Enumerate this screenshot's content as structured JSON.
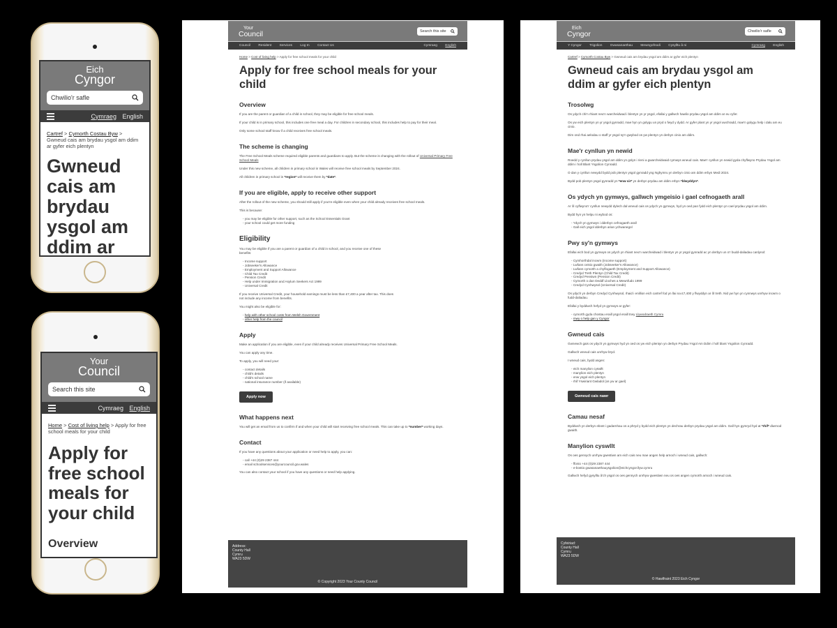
{
  "mobile_cy": {
    "logo_top": "Eich",
    "logo_bottom": "Cyngor",
    "search_placeholder": "Chwilio'r safle",
    "lang_cy": "Cymraeg",
    "lang_en": "English",
    "breadcrumb": [
      "Cartref",
      "Cymorth Costau Byw",
      "Gwneud cais am brydau ysgol am ddim ar gyfer eich plentyn"
    ],
    "title": "Gwneud cais am brydau ysgol am ddim ar gyfer eich plentyn"
  },
  "mobile_en": {
    "logo_top": "Your",
    "logo_bottom": "Council",
    "search_placeholder": "Search this site",
    "lang_cy": "Cymraeg",
    "lang_en": "English",
    "breadcrumb": [
      "Home",
      "Cost of living help",
      "Apply for free school meals for your child"
    ],
    "title": "Apply for free school meals for your child",
    "first_heading": "Overview"
  },
  "desktop_en": {
    "logo_top": "Your",
    "logo_bottom": "Council",
    "search_placeholder": "Search this site",
    "nav": [
      "Council",
      "Resident",
      "Services",
      "Log In",
      "Contact Us"
    ],
    "lang_cy": "Cymraeg",
    "lang_en": "English",
    "breadcrumb": [
      "Home",
      "Cost of living help",
      "Apply for free school meals for your child"
    ],
    "title": "Apply for free school meals for your child",
    "overview": {
      "heading": "Overview",
      "p1": "If you are the parent or guardian of a child in school, they may be eligible for free school meals.",
      "p2": "If your child is in primary school, this includes one free meal a day. For children in secondary school, this includes help to pay for their meal.",
      "p3": "Only some school staff know if a child receives free school meals."
    },
    "scheme": {
      "heading": "The scheme is changing",
      "p1_pre": "The Free School Meals scheme required eligible parents and guardians to apply. But the scheme is changing with the rollout of ",
      "p1_link": "Universal Primary Free School Meals",
      "p2": "Under this new scheme, all children in primary school in Wales will receive free school meals by September 2024.",
      "p3_pre": "All children in primary school in ",
      "p3_region": "*region*",
      "p3_mid": " will receive them by ",
      "p3_date": "*date*"
    },
    "other_support": {
      "heading": "If you are eligible, apply to receive other support",
      "p1": "After the rollout of the new scheme, you should still apply if you're eligible even when your child already receives free school meals.",
      "p2": "This is because:",
      "items": [
        "you may be eligible for other support, such as the School Essentials Grant",
        "your school could get more funding"
      ]
    },
    "eligibility": {
      "heading": "Eligibility",
      "p1": "You may be eligible if you are a parent or guardian of a child in school, and you receive one of these benefits:",
      "benefits": [
        "Income support",
        "Jobseeker's Allowance",
        "Employment and Support Allowance",
        "Child Tax Credit",
        "Pension Credit",
        "Help under Immigration and Asylum Seekers Act 1999",
        "Universal Credit"
      ],
      "p2": "If you receive Universal Credit, your household earnings must be less than £7,400 a year after tax. This does not include any income from benefits.",
      "p3": "You might also be eligible for:",
      "links": [
        "help with other school costs from Welsh Government",
        "other help from the council"
      ]
    },
    "apply": {
      "heading": "Apply",
      "p1": "Make an application if you are eligible, even if your child already receives Universal Primary Free School Meals.",
      "p2": "You can apply any time.",
      "p3": "To apply, you will need your:",
      "items": [
        "contact details",
        "child's details",
        "child's school name",
        "national insurance number (if available)"
      ],
      "button": "Apply now"
    },
    "next": {
      "heading": "What happens next",
      "p1_pre": "You will get an email from us to confirm if and when your child will start receiving free school meals. This can take up to ",
      "p1_num": "*number*",
      "p1_post": " working days."
    },
    "contact": {
      "heading": "Contact",
      "p1": "If you have any questions about your application or need help to apply, you can:",
      "items": [
        "call +44 (0)29 2387 444",
        "email schoolservices@yourcouncil.gov.wales"
      ],
      "p2": "You can also contact your school if you have any questions or need help applying."
    },
    "footer": {
      "address": [
        "Address:",
        "County Hall",
        "Cymru",
        "WA23 5DW"
      ],
      "copyright": "© Copyright 2023 Your County Council"
    }
  },
  "desktop_cy": {
    "logo_top": "Eich",
    "logo_bottom": "Cyngor",
    "search_placeholder": "Chwilio'r safle",
    "nav": [
      "Y Cyngor",
      "Trigolion",
      "Gwasanaethau",
      "Mewngofnodi",
      "Cysylltu â ni"
    ],
    "lang_cy": "Cymraeg",
    "lang_en": "English",
    "breadcrumb": [
      "Cartref",
      "Cymorth Costau Byw",
      "Gwneud cais am brydau ysgol am ddim ar gyfer eich plentyn"
    ],
    "title": "Gwneud cais am brydau ysgol am ddim ar gyfer eich plentyn",
    "overview": {
      "heading": "Trosolwg",
      "p1": "Os ydych chi'n rhiant neu'n warcheidwad i blentyn yn yr ysgol, efallai y gallwch hawlio prydau ysgol am ddim ar eu cyfer.",
      "p2": "Os yw eich plentyn yn yr ysgol gynradd, mae hyn yn golygu un pryd o fwyd y dydd. Ar gyfer plant yn yr ysgol uwchradd, mae'n golygu help i dalu am eu cinio.",
      "p3": "Dim ond rhai aelodau o staff yr ysgol sy'n gwybod os yw plentyn yn derbyn cinio am ddim."
    },
    "scheme": {
      "heading": "Mae'r cynllun yn newid",
      "p1": "Roedd y cynllun prydau ysgol am ddim yn golyn i rieni a gwarcheidwaid cymwys wneud cais. Mae'r cynllun yn newid gyda chyflwyno Prydau Ysgol am ddim i holl Blant Ysgolion Cynradd.",
      "p2": "O dan y cynllun newydd bydd pob plentyn ysgol gynradd yng Nghymru yn derbyn cinio am ddim erbyn Medi 2024.",
      "p3_pre": "Bydd pob plentyn ysgol gynradd yn ",
      "p3_region": "*enw sir*",
      "p3_mid": " yn derbyn prydau am ddim erbyn ",
      "p3_date": "*blwyddyn*"
    },
    "other_support": {
      "heading": "Os ydych yn gymwys, gallwch ymgeisio i gael cefnogaeth arall",
      "p1": "Ar ôl cyflwyno'r cynllun newydd dylech dal wneud cais os ydych yn gymwys, hyd yn oed pan fydd eich plentyn yn cael prydau ysgol am ddim.",
      "p2": "Bydd hyn yn helpu ni wybod os:",
      "items": [
        "Ydych yn gymwys i dderbyn cefnogaeth arall",
        "Gall eich ysgol dderbyn arian ychwanegol"
      ]
    },
    "eligibility": {
      "heading": "Pwy sy'n gymwys",
      "p1": "Efallai eich bod yn gymwys os ydych yn rhiant neu'n warcheidwad i blentyn yn yr ysgol gynradd ac yn derbyn un o'r budd-daliadau canlynol:",
      "benefits": [
        "Cymhorthdal incwm (Income support)",
        "Lwfans ceisio gwaith (Jobseeker's Allowance)",
        "Lwfans cymorth a chyflogaeth (Employment and Support Allowance)",
        "Credyd Treth Plentyn (Child Tax Credit)",
        "Credyd Pensiwn (Pension Credit)",
        "Cymorth o dan Deddf Lloches a Mewnfudo 1999",
        "Credyd Cynhwysol (Universal Credit)"
      ],
      "p2": "Os ydych yn derbyn Credyd Cynhwysol, rhaid i enillion eich cartref fod yn llai na £7,400 y flwyddyn ar ôl treth. Nid yw hyn yn cynnwys unrhyw incwm o fudd-daliadau.",
      "p3": "Efallai y byddwch hefyd yn gymwys ar gyfer:",
      "links_pre": "cymorth gyda chostau eraill ysgol eraill trwy ",
      "link1": "Llywodraeth Cymru",
      "link2": "mwy o help gan y Cyngor"
    },
    "apply": {
      "heading": "Gwneud cais",
      "p1": "Gwnewch gais os ydych yn gymwys hyd yn oed os yw eich plentyn yn derbyn Prydau Ysgol Am Ddim i holl blant Ysgolion Cynradd.",
      "p2": "Gallwch wneud cais unrhyw bryd.",
      "p3": "I wneud cais, bydd angen:",
      "items": [
        "eich manylion cyswllt",
        "manylion eich plentyn",
        "enw ysgol eich plentyn",
        "rhif Yswiriant Gwladol (os yw ar gael)"
      ],
      "button": "Gwneud cais nawr"
    },
    "next": {
      "heading": "Camau nesaf",
      "p1_pre": "Byddwch yn derbyn ebost i gadarnhau os a phryd y bydd eich plentyn yn dechrau derbyn prydau ysgol am ddim. Gall hyn gymryd hyd at ",
      "p1_num": "*rhif*",
      "p1_post": " diwrnod gwaith."
    },
    "contact": {
      "heading": "Manylion cyswllt",
      "p1": "Os oes gennych unrhyw gwestiwn am eich cais neu mae angen help arnoch i wneud cais, gallwch:",
      "items": [
        "ffonio +44 (0)29 2387 444",
        "e-bostio gwasanaethauysgolion@eichcyngor.llyw.cymru"
      ],
      "p2": "Gallwch hefyd gysylltu â'ch ysgol os oes gennych unrhyw gwestiwn neu os oes angen cymorth arnoch i wneud cais."
    },
    "footer": {
      "address": [
        "Cyfeiriad:",
        "County Hall",
        "Cymru",
        "WA23 5DW"
      ],
      "copyright": "© Hawlfraint 2023 Eich Cyngor"
    },
    "icons": {
      "search": "search-icon",
      "menu": "hamburger-menu-icon"
    }
  }
}
